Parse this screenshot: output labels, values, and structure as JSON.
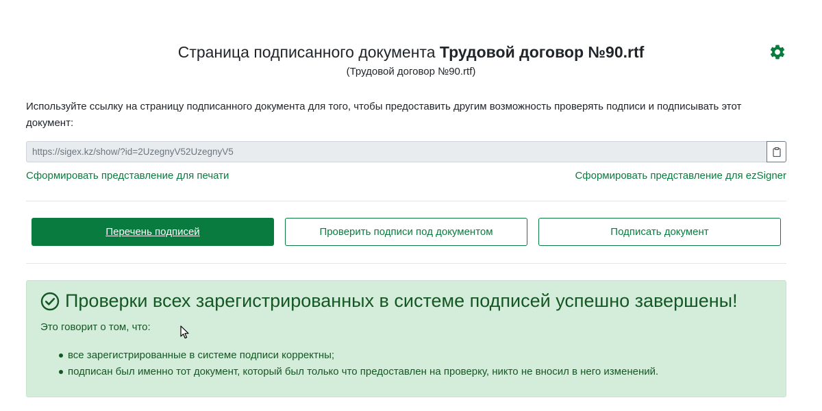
{
  "header": {
    "title_prefix": "Страница подписанного документа ",
    "title_doc": "Трудовой договор №90.rtf",
    "subtitle": "(Трудовой договор №90.rtf)"
  },
  "settings": {
    "icon": "gear-icon"
  },
  "description": "Используйте ссылку на страницу подписанного документа для того, чтобы предоставить другим возможность проверять подписи и подписывать этот документ:",
  "link": {
    "value": "https://sigex.kz/show/?id=2UzegnyV52UzegnyV5",
    "copy_icon": "clipboard-icon"
  },
  "links": {
    "print": "Сформировать представление для печати",
    "ezsigner": "Сформировать представление для ezSigner"
  },
  "buttons": {
    "signatures_list": "Перечень подписей",
    "verify": "Проверить подписи под документом",
    "sign": "Подписать документ"
  },
  "alert": {
    "heading": "Проверки всех зарегистрированных в системе подписей успешно завершены!",
    "subtext": "Это говорит о том, что:",
    "items": [
      "все зарегистрированные в системе подписи корректны;",
      "подписан был именно тот документ, который был только что предоставлен на проверку, никто не вносил в него изменений."
    ],
    "icon": "check-circle-icon"
  },
  "colors": {
    "primary": "#0a7b3e",
    "success_bg": "#d4edda",
    "success_text": "#155724"
  }
}
